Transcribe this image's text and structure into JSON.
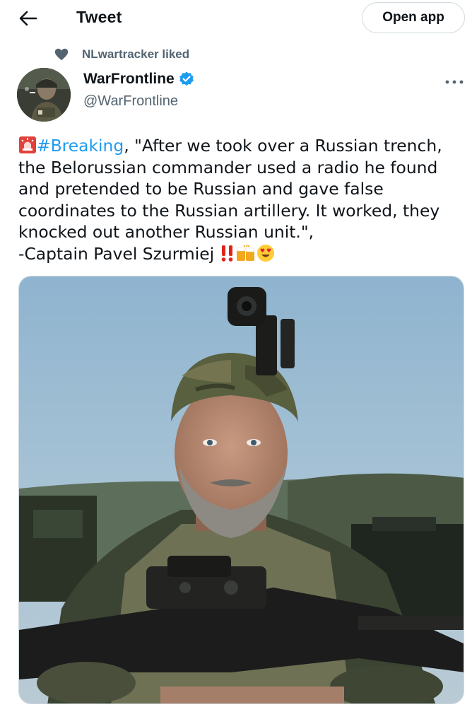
{
  "header": {
    "title": "Tweet",
    "open_app_label": "Open app"
  },
  "social_context": {
    "text": "NLwartracker liked"
  },
  "author": {
    "display_name": "WarFrontline",
    "handle": "@WarFrontline"
  },
  "tweet": {
    "hashtag": "#Breaking",
    "body_after_hashtag": ", \"After we took over a Russian trench, the Belorussian commander used a radio he found and pretended to be Russian and gave false coordinates to the Russian artillery. It worked, they knocked out another Russian unit.\",",
    "signature": "-Captain Pavel Szurmiej",
    "emojis": [
      "police-light-emoji",
      "double-exclamation-emoji",
      "beer-mugs-emoji",
      "heart-eyes-emoji"
    ]
  },
  "media": {
    "type": "photo",
    "subject": "soldier"
  },
  "colors": {
    "accent": "#1d9bf0",
    "secondary_text": "#536471",
    "primary_text": "#0f1419",
    "border": "#cfd9de"
  }
}
